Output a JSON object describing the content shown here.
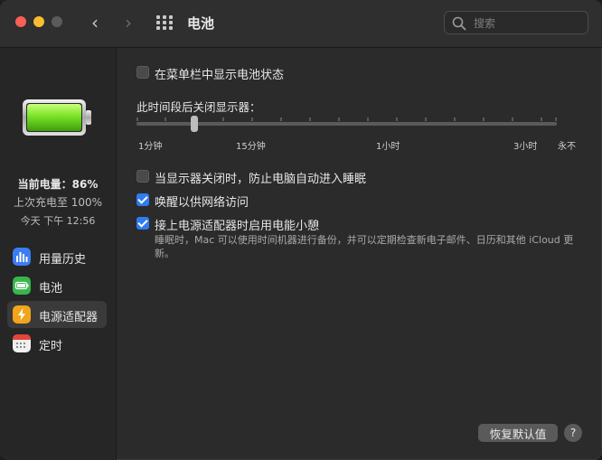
{
  "window": {
    "title": "电池"
  },
  "search": {
    "placeholder": "搜索"
  },
  "sidebar": {
    "charge_current": "当前电量：86%",
    "last_charged": "上次充电至 100%",
    "timestamp": "今天 下午 12:56",
    "items": [
      {
        "label": "用量历史",
        "icon": "usage-history-icon",
        "color": "#3b7df5"
      },
      {
        "label": "电池",
        "icon": "battery-icon",
        "color": "#37b64b"
      },
      {
        "label": "电源适配器",
        "icon": "power-adapter-icon",
        "color": "#f2a41a",
        "active": true
      },
      {
        "label": "定时",
        "icon": "schedule-icon",
        "color": "#e8e8e8"
      }
    ]
  },
  "main": {
    "show_in_menubar": {
      "label": "在菜单栏中显示电池状态",
      "checked": false
    },
    "display_off_label": "此时间段后关闭显示器：",
    "slider": {
      "value": "15分钟",
      "tick_labels": [
        "1分钟",
        "15分钟",
        "1小时",
        "3小时",
        "永不"
      ]
    },
    "prevent_sleep": {
      "label": "当显示器关闭时，防止电脑自动进入睡眠",
      "checked": false
    },
    "wake_network": {
      "label": "唤醒以供网络访问",
      "checked": true
    },
    "power_nap": {
      "label": "接上电源适配器时启用电能小憩",
      "checked": true
    },
    "power_nap_note": "睡眠时，Mac 可以使用时间机器进行备份，并可以定期检查新电子邮件、日历和其他 iCloud 更新。",
    "restore_defaults": "恢复默认值",
    "help": "?"
  }
}
